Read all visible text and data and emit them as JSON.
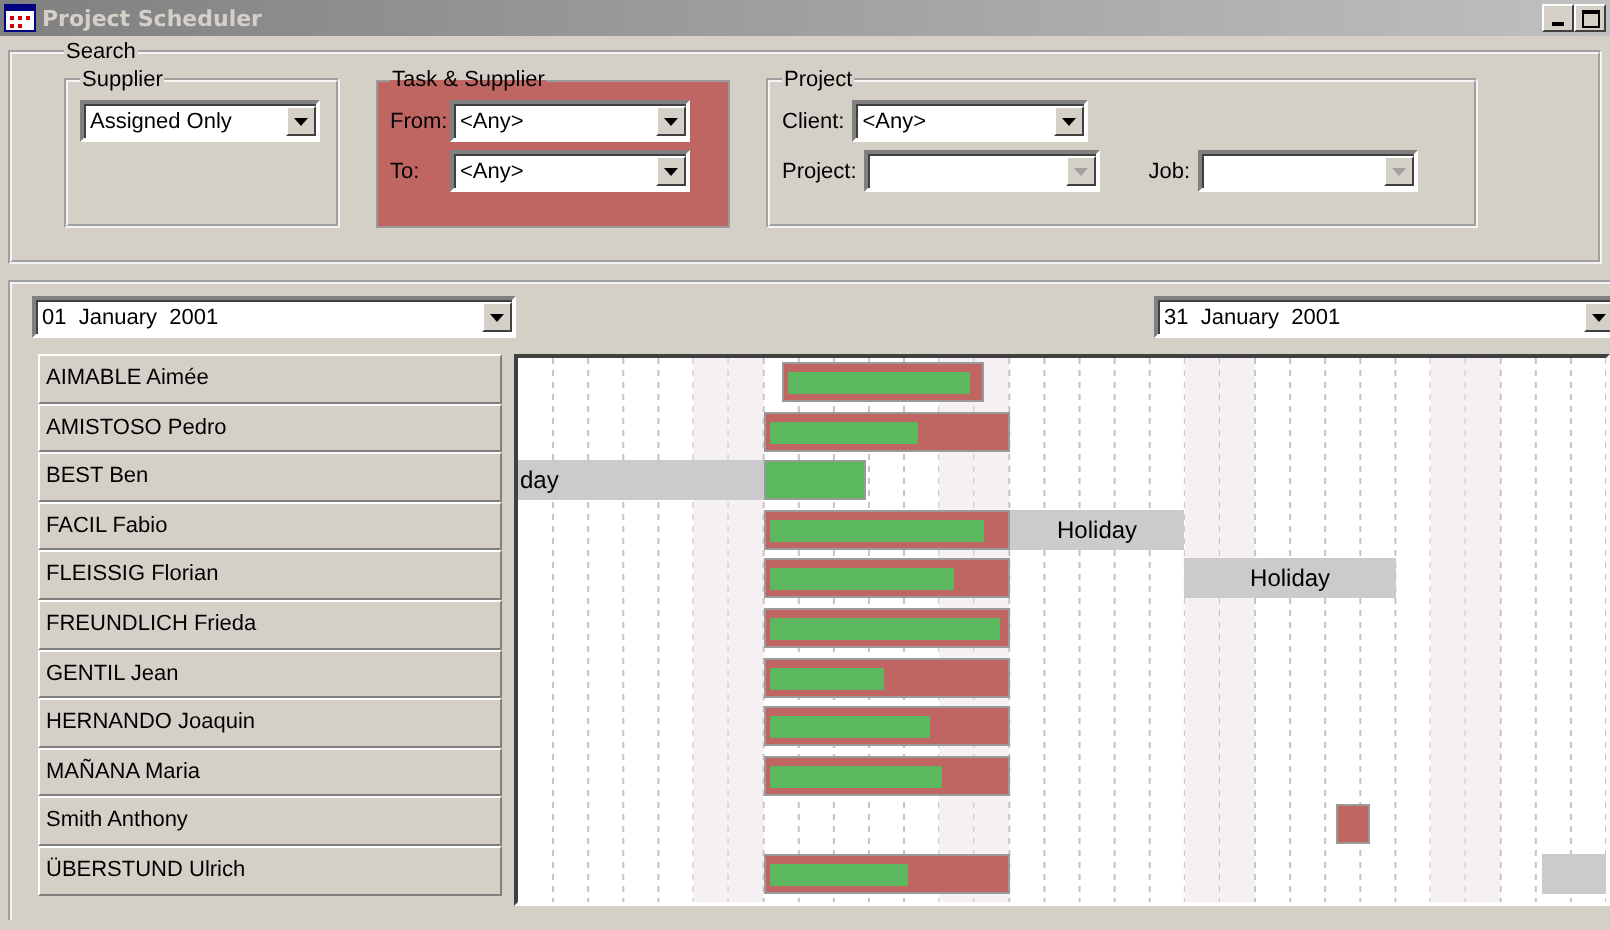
{
  "window": {
    "title": "Project Scheduler"
  },
  "search": {
    "title": "Search",
    "supplier": {
      "title": "Supplier",
      "value": "Assigned Only"
    },
    "task_supplier": {
      "title": "Task & Supplier",
      "fields": [
        {
          "label": "From:",
          "value": "<Any>",
          "disabled": false
        },
        {
          "label": "To:",
          "value": "<Any>",
          "disabled": false
        }
      ]
    },
    "project": {
      "title": "Project",
      "fields": [
        {
          "label": "Client:",
          "value": "<Any>",
          "disabled": false
        },
        {
          "label": "Project:",
          "disabled": true
        },
        {
          "label": "Job:",
          "disabled": true
        }
      ]
    }
  },
  "dates": {
    "from": "01  January  2001",
    "to": "31  January  2001"
  },
  "resources": [
    {
      "name": "AIMABLE Aimée",
      "bars": [
        {
          "kind": "task",
          "level": 0.98
        }
      ]
    },
    {
      "name": "AMISTOSO Pedro",
      "bars": [
        {
          "kind": "task",
          "level": 0.65
        }
      ]
    },
    {
      "name": "BEST Ben",
      "bars": [
        {
          "kind": "holiday",
          "label": "day"
        },
        {
          "kind": "done"
        }
      ]
    },
    {
      "name": "FACIL Fabio",
      "bars": [
        {
          "kind": "task",
          "level": 0.93
        },
        {
          "kind": "holiday",
          "label": "Holiday"
        }
      ]
    },
    {
      "name": "FLEISSIG Florian",
      "bars": [
        {
          "kind": "task",
          "level": 0.8
        },
        {
          "kind": "holiday",
          "label": "Holiday"
        }
      ]
    },
    {
      "name": "FREUNDLICH Frieda",
      "bars": [
        {
          "kind": "task",
          "level": 1
        }
      ]
    },
    {
      "name": "GENTIL Jean",
      "bars": [
        {
          "kind": "task",
          "level": 0.5
        }
      ]
    },
    {
      "name": "HERNANDO Joaquin",
      "bars": [
        {
          "kind": "task",
          "level": 0.7
        }
      ]
    },
    {
      "name": "MAÑANA Maria",
      "bars": [
        {
          "kind": "task",
          "level": 0.75
        }
      ]
    },
    {
      "name": "Smith  Anthony",
      "bars": [
        {
          "kind": "task"
        }
      ]
    },
    {
      "name": "ÜBERSTUND Ulrich",
      "bars": [
        {
          "kind": "task",
          "level": 0.6
        },
        {
          "kind": "holiday"
        }
      ]
    }
  ]
}
